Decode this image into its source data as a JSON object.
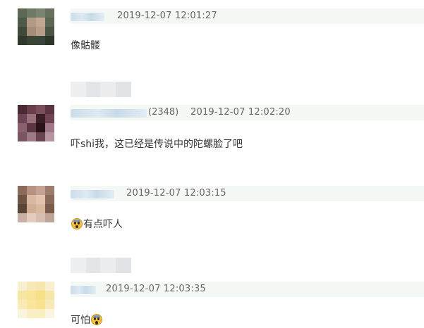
{
  "comments": [
    {
      "time": "2019-12-07 12:01:27",
      "text": "像骷髅"
    },
    {
      "count": "(2348)",
      "time": "2019-12-07 12:02:20",
      "text": "吓shi我，这已经是传说中的陀螺脸了吧"
    },
    {
      "time": "2019-12-07 12:03:15",
      "text": "有点吓人",
      "emoji": "fearful-face-icon"
    },
    {
      "time": "2019-12-07 12:03:35",
      "text": "可怕",
      "emoji": "scream-face-icon"
    }
  ],
  "colors": {
    "meta_bar_bg": "#f3f8f5",
    "meta_text": "#666666",
    "body_text": "#333333"
  }
}
